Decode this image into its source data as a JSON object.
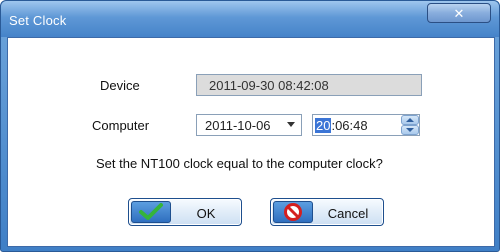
{
  "window": {
    "title": "Set Clock",
    "close_icon": "close-icon"
  },
  "device": {
    "label": "Device",
    "value": "2011-09-30 08:42:08"
  },
  "computer": {
    "label": "Computer",
    "date_value": "2011-10-06",
    "time_hours": "20",
    "time_rest": ":06:48"
  },
  "prompt": {
    "question": "Set the NT100 clock equal to the computer clock?"
  },
  "buttons": {
    "ok_label": "OK",
    "cancel_label": "Cancel",
    "ok_icon": "checkmark-icon",
    "cancel_icon": "prohibited-icon"
  },
  "colors": {
    "title_bar": "#4583c9",
    "ok_check": "#35b43a",
    "cancel_icon": "#d41f1f",
    "selection": "#3b75d6"
  }
}
